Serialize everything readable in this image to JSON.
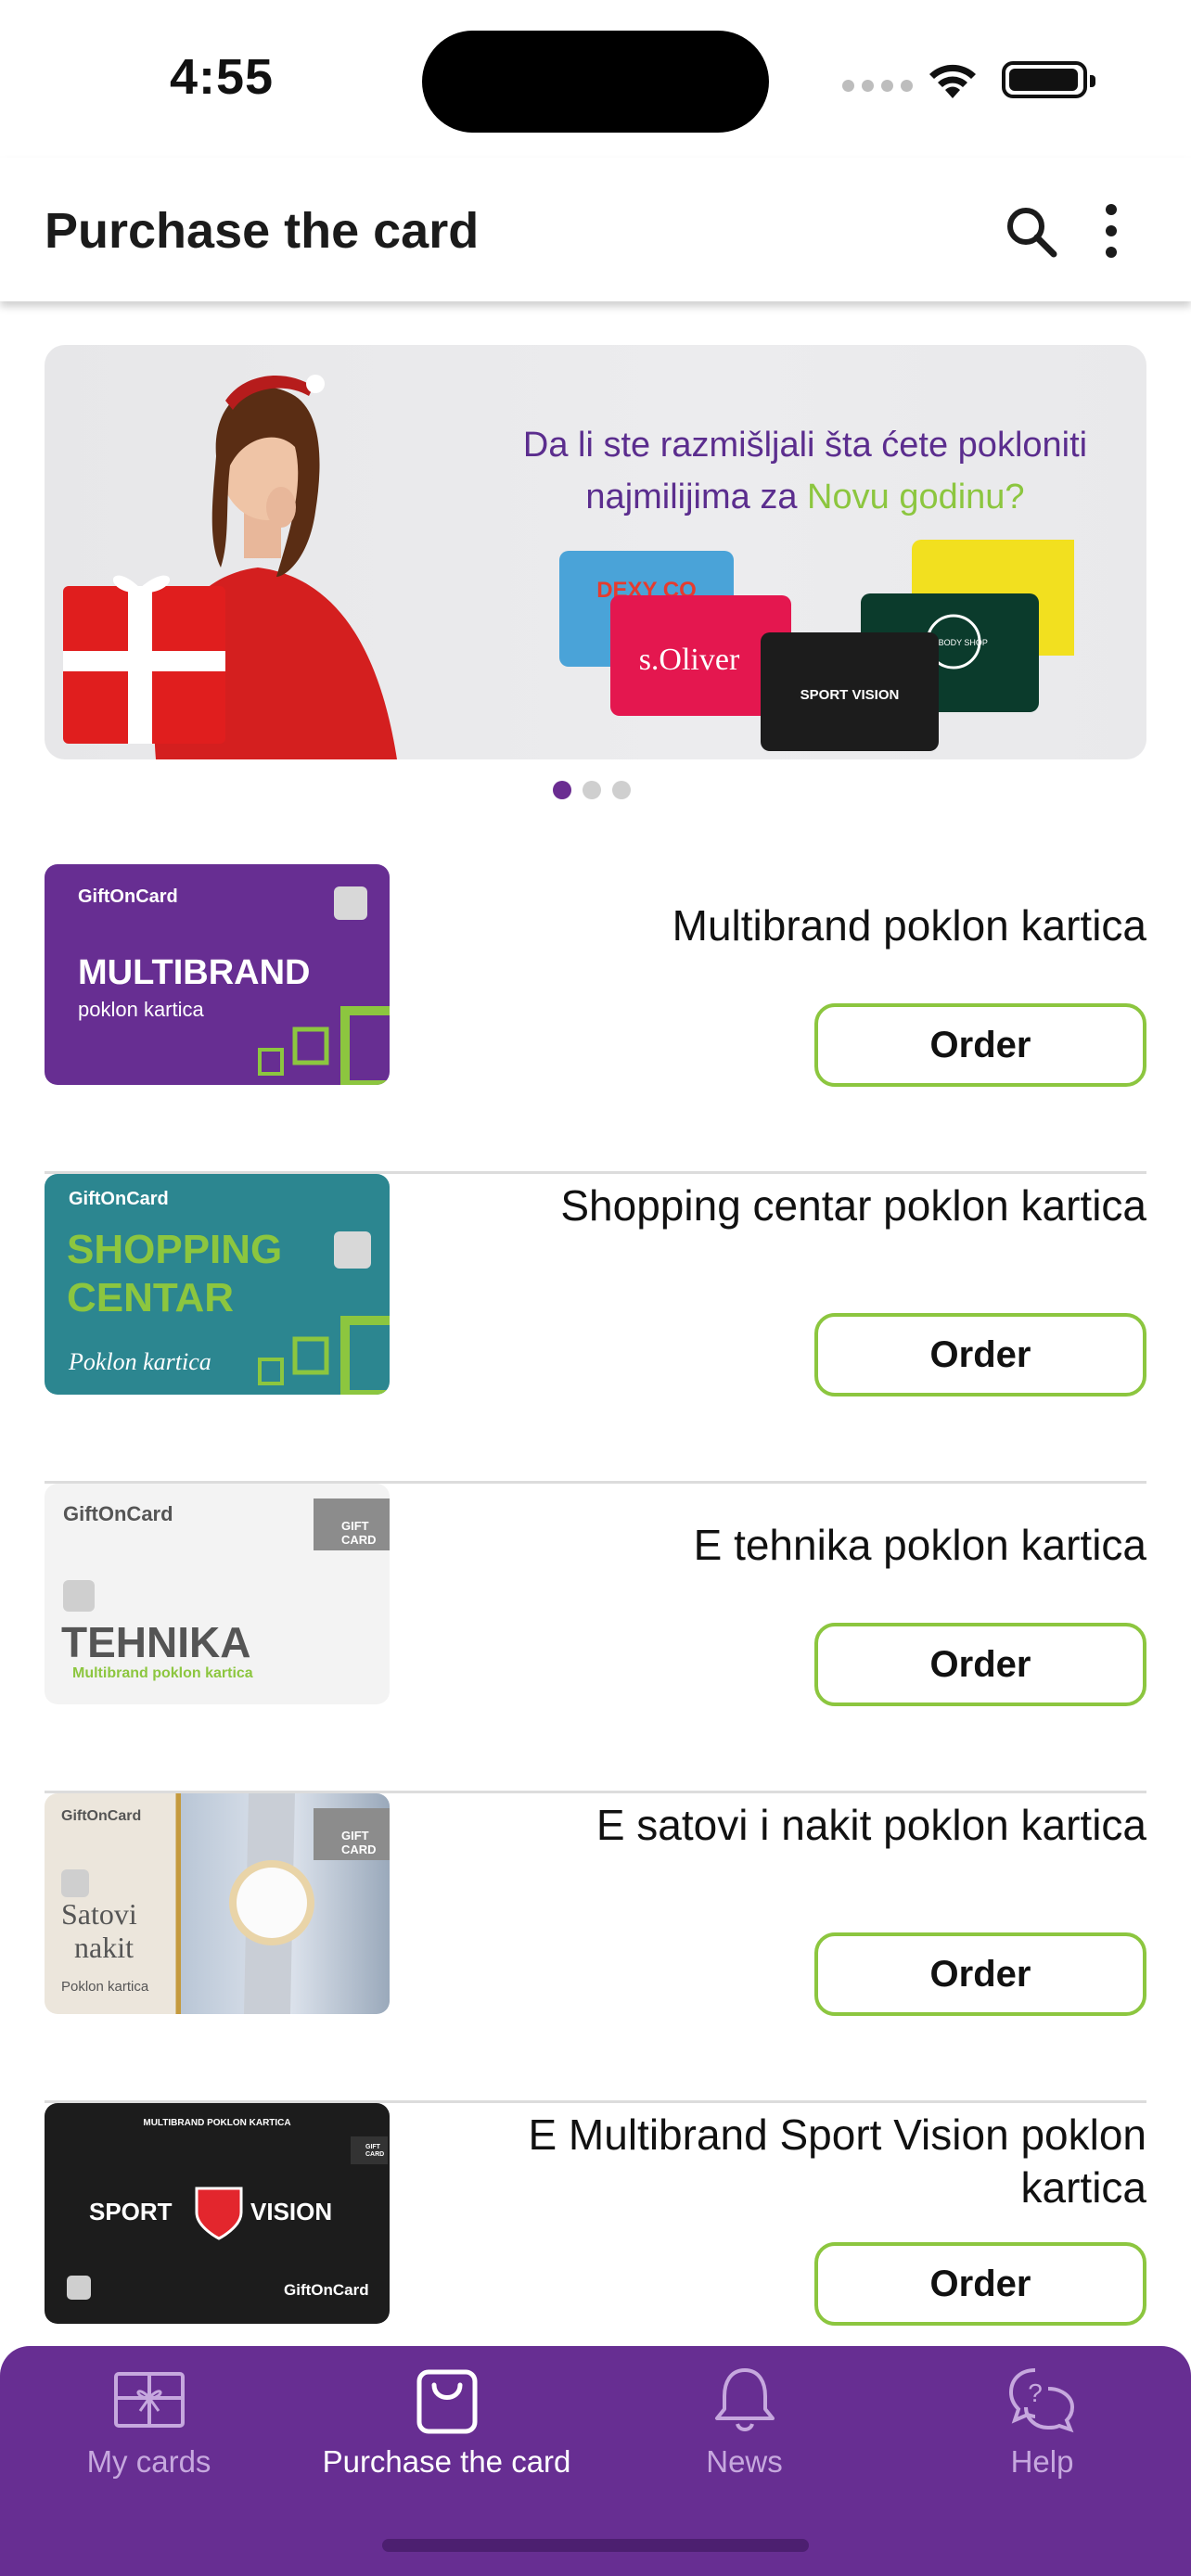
{
  "status_bar": {
    "time": "4:55"
  },
  "app_bar": {
    "title": "Purchase the card",
    "search_icon": "search-icon",
    "more_icon": "more-vertical-icon"
  },
  "banner": {
    "line1": "Da li ste razmišljali šta ćete pokloniti",
    "line2_part1": "najmilijima za ",
    "line2_highlight": "Novu godinu?",
    "card_brands": [
      "DEXY CO",
      "s.Oliver",
      "SPORT VISION",
      "THE BODY SHOP"
    ],
    "page_count": 3,
    "active_page": 1
  },
  "cards_list": [
    {
      "name": "Multibrand poklon kartica",
      "order_label": "Order",
      "thumb": {
        "brand": "GiftOnCard",
        "title": "MULTIBRAND",
        "subtitle": "poklon kartica",
        "bg": "#672e92"
      }
    },
    {
      "name": "Shopping centar poklon kartica",
      "order_label": "Order",
      "thumb": {
        "brand": "GiftOnCard",
        "title1": "SHOPPING",
        "title2": "CENTAR",
        "subtitle": "Poklon kartica",
        "bg": "#2c8690"
      }
    },
    {
      "name": "E tehnika poklon kartica",
      "order_label": "Order",
      "thumb": {
        "brand": "GiftOnCard",
        "title": "TEHNIKA",
        "subtitle": "Multibrand poklon kartica",
        "badge": "GIFT CARD",
        "bg": "#f2f2f2"
      }
    },
    {
      "name": "E satovi i nakit poklon kartica",
      "order_label": "Order",
      "thumb": {
        "brand": "GiftOnCard",
        "title1": "Satovi",
        "title2": "nakit",
        "subtitle": "Poklon kartica",
        "badge": "GIFT CARD"
      }
    },
    {
      "name": "E Multibrand Sport Vision poklon kartica",
      "order_label": "Order",
      "thumb": {
        "top": "MULTIBRAND POKLON KARTICA",
        "title1": "SPORT",
        "title2": "VISION",
        "brand": "GiftOnCard",
        "badge": "GIFT CARD",
        "bg": "#1c1c1c"
      }
    }
  ],
  "bottom_nav": [
    {
      "label": "My cards",
      "icon": "gift-card-icon",
      "active": false
    },
    {
      "label": "Purchase the card",
      "icon": "shopping-bag-icon",
      "active": true
    },
    {
      "label": "News",
      "icon": "bell-icon",
      "active": false
    },
    {
      "label": "Help",
      "icon": "help-chat-icon",
      "active": false
    }
  ],
  "colors": {
    "primary": "#672e92",
    "accent": "#8cc63f"
  }
}
